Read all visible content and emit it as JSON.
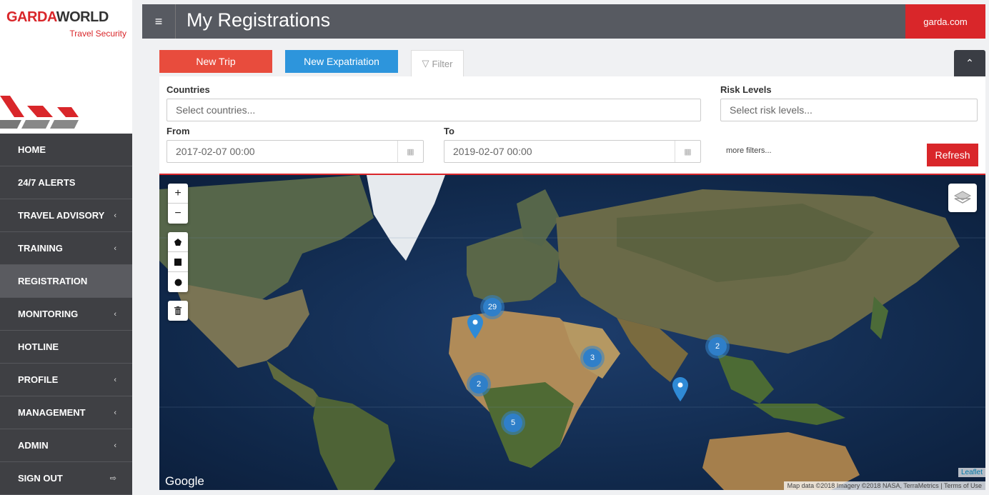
{
  "brand": {
    "name_red": "GARDA",
    "name_dark": "WORLD",
    "subtitle": "Travel Security"
  },
  "topbar": {
    "menu_icon": "hamburger-icon",
    "title": "My Registrations",
    "site_link": "garda.com"
  },
  "sidebar": {
    "items": [
      {
        "label": "HOME",
        "has_submenu": false
      },
      {
        "label": "24/7 ALERTS",
        "has_submenu": false
      },
      {
        "label": "TRAVEL ADVISORY",
        "has_submenu": true
      },
      {
        "label": "TRAINING",
        "has_submenu": true
      },
      {
        "label": "REGISTRATION",
        "has_submenu": false,
        "active": true
      },
      {
        "label": "MONITORING",
        "has_submenu": true
      },
      {
        "label": "HOTLINE",
        "has_submenu": false
      },
      {
        "label": "PROFILE",
        "has_submenu": true
      },
      {
        "label": "MANAGEMENT",
        "has_submenu": true
      },
      {
        "label": "ADMIN",
        "has_submenu": true
      },
      {
        "label": "SIGN OUT",
        "has_submenu": false
      }
    ],
    "chevron": "‹",
    "signout_icon": "⇨"
  },
  "actions": {
    "new_trip": "New Trip",
    "new_expat": "New Expatriation",
    "filter_tab": "Filter"
  },
  "filters": {
    "countries_label": "Countries",
    "countries_placeholder": "Select countries...",
    "risk_label": "Risk Levels",
    "risk_placeholder": "Select risk levels...",
    "from_label": "From",
    "from_value": "2017-02-07 00:00",
    "to_label": "To",
    "to_value": "2019-02-07 00:00",
    "more_filters": "more filters...",
    "refresh": "Refresh"
  },
  "map": {
    "zoom_in": "+",
    "zoom_out": "−",
    "draw_tools": [
      "polygon-icon",
      "rectangle-icon",
      "circle-icon"
    ],
    "delete_icon": "trash-icon",
    "clusters": [
      {
        "count": "29"
      },
      {
        "count": "3"
      },
      {
        "count": "2"
      },
      {
        "count": "2"
      },
      {
        "count": "5"
      }
    ],
    "google": "Google",
    "leaflet": "Leaflet",
    "attribution": "Map data ©2018 Imagery ©2018 NASA, TerraMetrics | Terms of Use"
  },
  "colors": {
    "brand_red": "#d9262a",
    "sidebar_bg": "#3f4044",
    "topbar_bg": "#575a61",
    "blue": "#2d95dc",
    "orange_red": "#e84c3d"
  }
}
